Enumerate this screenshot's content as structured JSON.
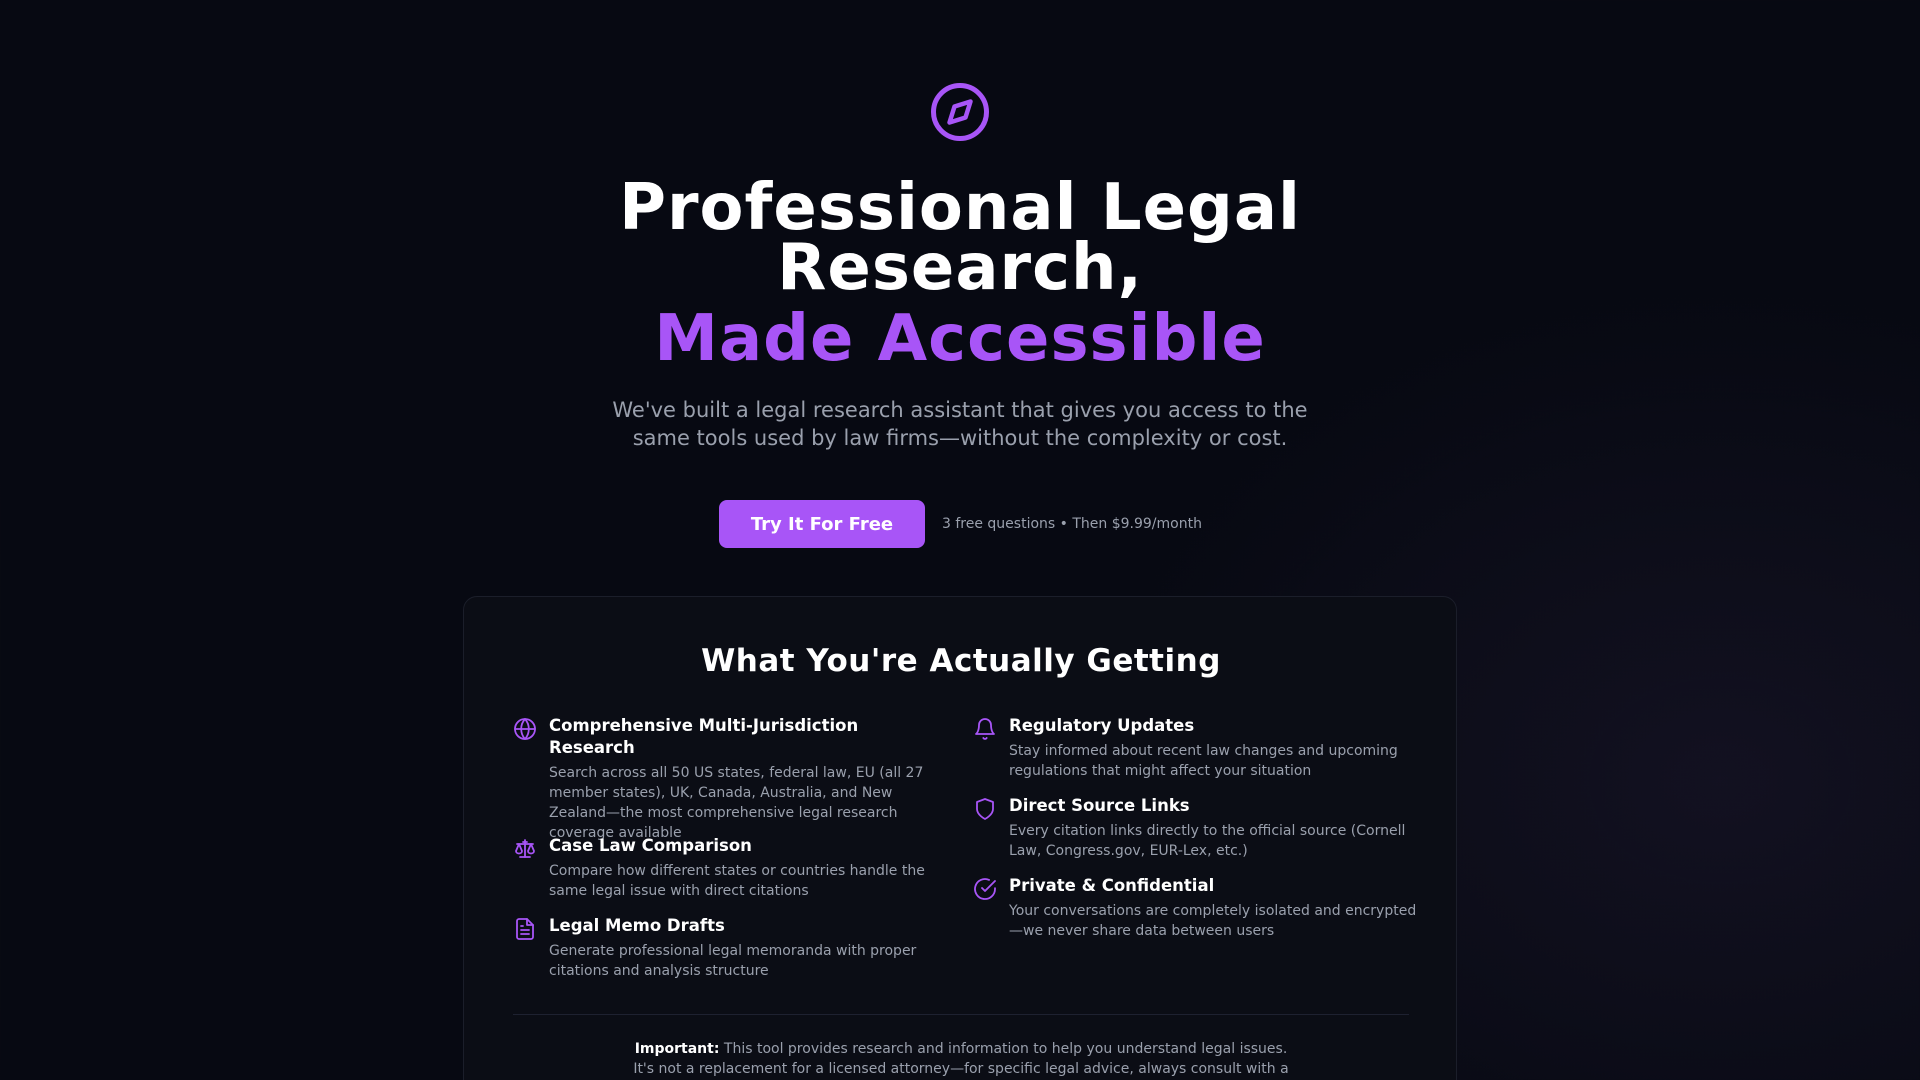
{
  "hero": {
    "logo_icon": "compass-icon",
    "title_line": "Professional Legal Research,",
    "title_accent": "Made Accessible",
    "subtitle": "We've built a legal research assistant that gives you access to the same tools used by law firms—without the complexity or cost.",
    "cta_label": "Try It For Free",
    "cta_note": "3 free questions • Then $9.99/month"
  },
  "features_section": {
    "title": "What You're Actually Getting",
    "left": [
      {
        "icon": "globe-icon",
        "title": "Comprehensive Multi-Jurisdiction Research",
        "description": "Search across all 50 US states, federal law, EU (all 27 member states), UK, Canada, Australia, and New Zealand—the most comprehensive legal research coverage available"
      },
      {
        "icon": "scale-icon",
        "title": "Case Law Comparison",
        "description": "Compare how different states or countries handle the same legal issue with direct citations"
      },
      {
        "icon": "document-icon",
        "title": "Legal Memo Drafts",
        "description": "Generate professional legal memoranda with proper citations and analysis structure"
      }
    ],
    "right": [
      {
        "icon": "bell-icon",
        "title": "Regulatory Updates",
        "description": "Stay informed about recent law changes and upcoming regulations that might affect your situation"
      },
      {
        "icon": "shield-icon",
        "title": "Direct Source Links",
        "description": "Every citation links directly to the official source (Cornell Law, Congress.gov, EUR-Lex, etc.)"
      },
      {
        "icon": "check-circle-icon",
        "title": "Private & Confidential",
        "description": "Your conversations are completely isolated and encrypted—we never share data between users"
      }
    ],
    "important_label": "Important:",
    "important_text": "This tool provides research and information to help you understand legal issues. It's not a replacement for a licensed attorney—for specific legal advice, always consult with a"
  },
  "colors": {
    "accent": "#a855f7",
    "background": "#070912",
    "muted_text": "#9aa0ad"
  }
}
